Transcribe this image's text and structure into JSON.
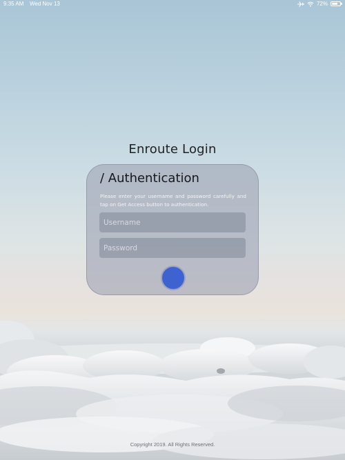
{
  "status_bar": {
    "time": "9:35 AM",
    "date": "Wed Nov 13",
    "battery_text": "72%",
    "battery_level": 0.72,
    "airplane_icon": "airplane-icon",
    "wifi_icon": "wifi-icon",
    "battery_icon": "battery-icon"
  },
  "screen": {
    "title": "Enroute Login"
  },
  "card": {
    "heading": "/ Authentication",
    "description": "Please enter your username and password carefully and tap on Get Access button to authentication.",
    "username_placeholder": "Username",
    "username_value": "",
    "password_placeholder": "Password",
    "password_value": ""
  },
  "footer": {
    "copyright": "Copyright 2019. All Rights Reserved."
  },
  "colors": {
    "accent": "#3f62d1",
    "card_bg": "#a0a5b4",
    "field_bg": "#828898"
  }
}
